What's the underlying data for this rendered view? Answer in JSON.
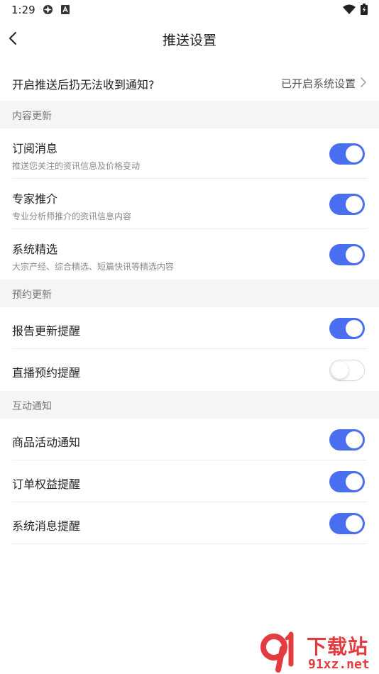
{
  "status_bar": {
    "time": "1:29"
  },
  "header": {
    "title": "推送设置"
  },
  "notice": {
    "label": "开启推送后扔无法收到通知?",
    "value": "已开启系统设置"
  },
  "sections": [
    {
      "title": "内容更新",
      "items": [
        {
          "title": "订阅消息",
          "desc": "推送您关注的资讯信息及价格变动",
          "enabled": true
        },
        {
          "title": "专家推介",
          "desc": "专业分析师推介的资讯信息内容",
          "enabled": true
        },
        {
          "title": "系统精选",
          "desc": "大宗产经、综合精选、短篇快讯等精选内容",
          "enabled": true
        }
      ]
    },
    {
      "title": "预约更新",
      "items": [
        {
          "title": "报告更新提醒",
          "enabled": true
        },
        {
          "title": "直播预约提醒",
          "enabled": false
        }
      ]
    },
    {
      "title": "互动通知",
      "items": [
        {
          "title": "商品活动通知",
          "enabled": true
        },
        {
          "title": "订单权益提醒",
          "enabled": true
        },
        {
          "title": "系统消息提醒",
          "enabled": true
        }
      ]
    }
  ],
  "watermark": {
    "text": "下载站",
    "url_text": "91xz.net"
  },
  "colors": {
    "toggle_on": "#4a6ef0",
    "section_bg": "#f5f5f7",
    "watermark": "#e23b40"
  }
}
